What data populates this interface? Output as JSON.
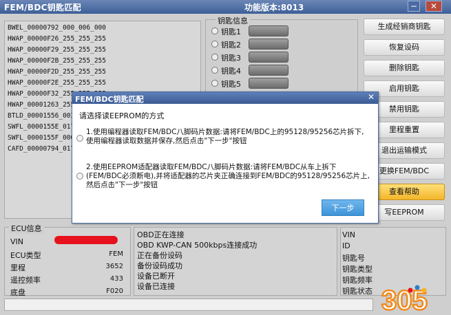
{
  "window": {
    "title": "FEM/BDC钥匙匹配",
    "version": "功能版本:8013",
    "min_glyph": "−",
    "close_glyph": "✕"
  },
  "key_list": [
    "BWEL_00000792_000_006_000",
    "HWAP_00000F26_255_255_255",
    "HWAP_00000F29_255_255_255",
    "HWAP_00000F2B_255_255_255",
    "HWAP_00000F2D_255_255_255",
    "HWAP_00000F2E_255_255_255",
    "HWAP_00000F32_255_255_255",
    "HWAP_00001263_255_255_255",
    "BTLD_00001556_003",
    "SWFL_0000155E_017",
    "SWFL_0000155F_000",
    "CAFD_00000794_017"
  ],
  "key_info": {
    "legend": "钥匙信息",
    "keys": [
      "钥匙1",
      "钥匙2",
      "钥匙3",
      "钥匙4",
      "钥匙5"
    ]
  },
  "right_buttons": [
    "生成经销商钥匙",
    "恢复设码",
    "删除钥匙",
    "启用钥匙",
    "禁用钥匙",
    "里程重置",
    "退出运输模式",
    "更换FEM/BDC",
    "查看帮助",
    "写EEPROM"
  ],
  "ecu_info": {
    "legend": "ECU信息",
    "rows": [
      {
        "label": "VIN",
        "value": ""
      },
      {
        "label": "ECU类型",
        "value": "FEM"
      },
      {
        "label": "里程",
        "value": "3652"
      },
      {
        "label": "遥控频率",
        "value": "433"
      },
      {
        "label": "底盘",
        "value": "F020"
      }
    ]
  },
  "obd_log": [
    "OBD正在连接",
    "OBD  KWP-CAN  500kbps连接成功",
    "正在备份设码",
    "备份设码成功",
    "设备已断开",
    "设备已连接"
  ],
  "key_status": [
    "VIN",
    "ID",
    "钥匙号",
    "钥匙类型",
    "钥匙频率",
    "钥匙状态"
  ],
  "dialog": {
    "title": "FEM/BDC钥匙匹配",
    "close_glyph": "✕",
    "prompt": "请选择读EEPROM的方式",
    "option1": "1.使用编程器读取FEM/BDC八脚码片数据:请将FEM/BDC上的95128/95256芯片拆下,使用编程器读取数据并保存,然后点击\"下一步\"按钮",
    "option2": "2.使用EEPROM适配器读取FEM/BDC八脚码片数据:请将FEM/BDC从车上拆下(FEM/BDC必须断电),并将适配器的芯片夹正确连接到FEM/BDC的95128/95256芯片上,然后点击\"下一步\"按钮",
    "next_button": "下一步"
  },
  "watermark": {
    "text": "305"
  },
  "colors": {
    "accent_blue": "#3d5f98",
    "next_button": "#3d94d8",
    "active_button": "#f3b52a",
    "vin_mask": "#e8121e"
  }
}
